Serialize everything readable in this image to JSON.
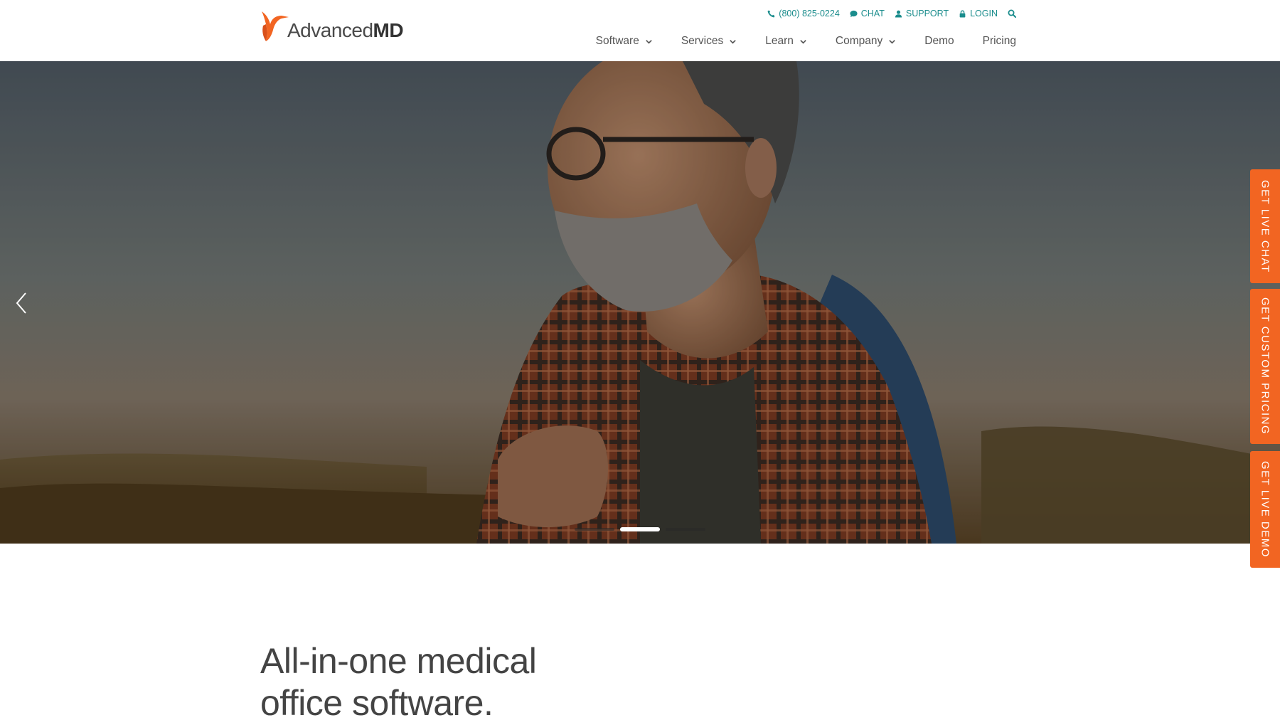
{
  "brand": {
    "name_light": "Advanced",
    "name_bold": "MD"
  },
  "utility": {
    "phone": "(800) 825-0224",
    "chat": "CHAT",
    "support": "SUPPORT",
    "login": "LOGIN"
  },
  "nav": {
    "items": [
      {
        "label": "Software",
        "dropdown": true
      },
      {
        "label": "Services",
        "dropdown": true
      },
      {
        "label": "Learn",
        "dropdown": true
      },
      {
        "label": "Company",
        "dropdown": true
      },
      {
        "label": "Demo",
        "dropdown": false
      },
      {
        "label": "Pricing",
        "dropdown": false
      }
    ]
  },
  "hero": {
    "slides": 3,
    "active_slide": 2
  },
  "side_tabs": {
    "live_chat": "GET LIVE CHAT",
    "custom_pricing": "GET CUSTOM PRICING",
    "live_demo": "GET LIVE DEMO"
  },
  "headline": {
    "line1": "All-in-one medical",
    "line2": "office software."
  },
  "colors": {
    "accent": "#f26522",
    "utility_link": "#1a8c8c",
    "nav_text": "#555555"
  }
}
